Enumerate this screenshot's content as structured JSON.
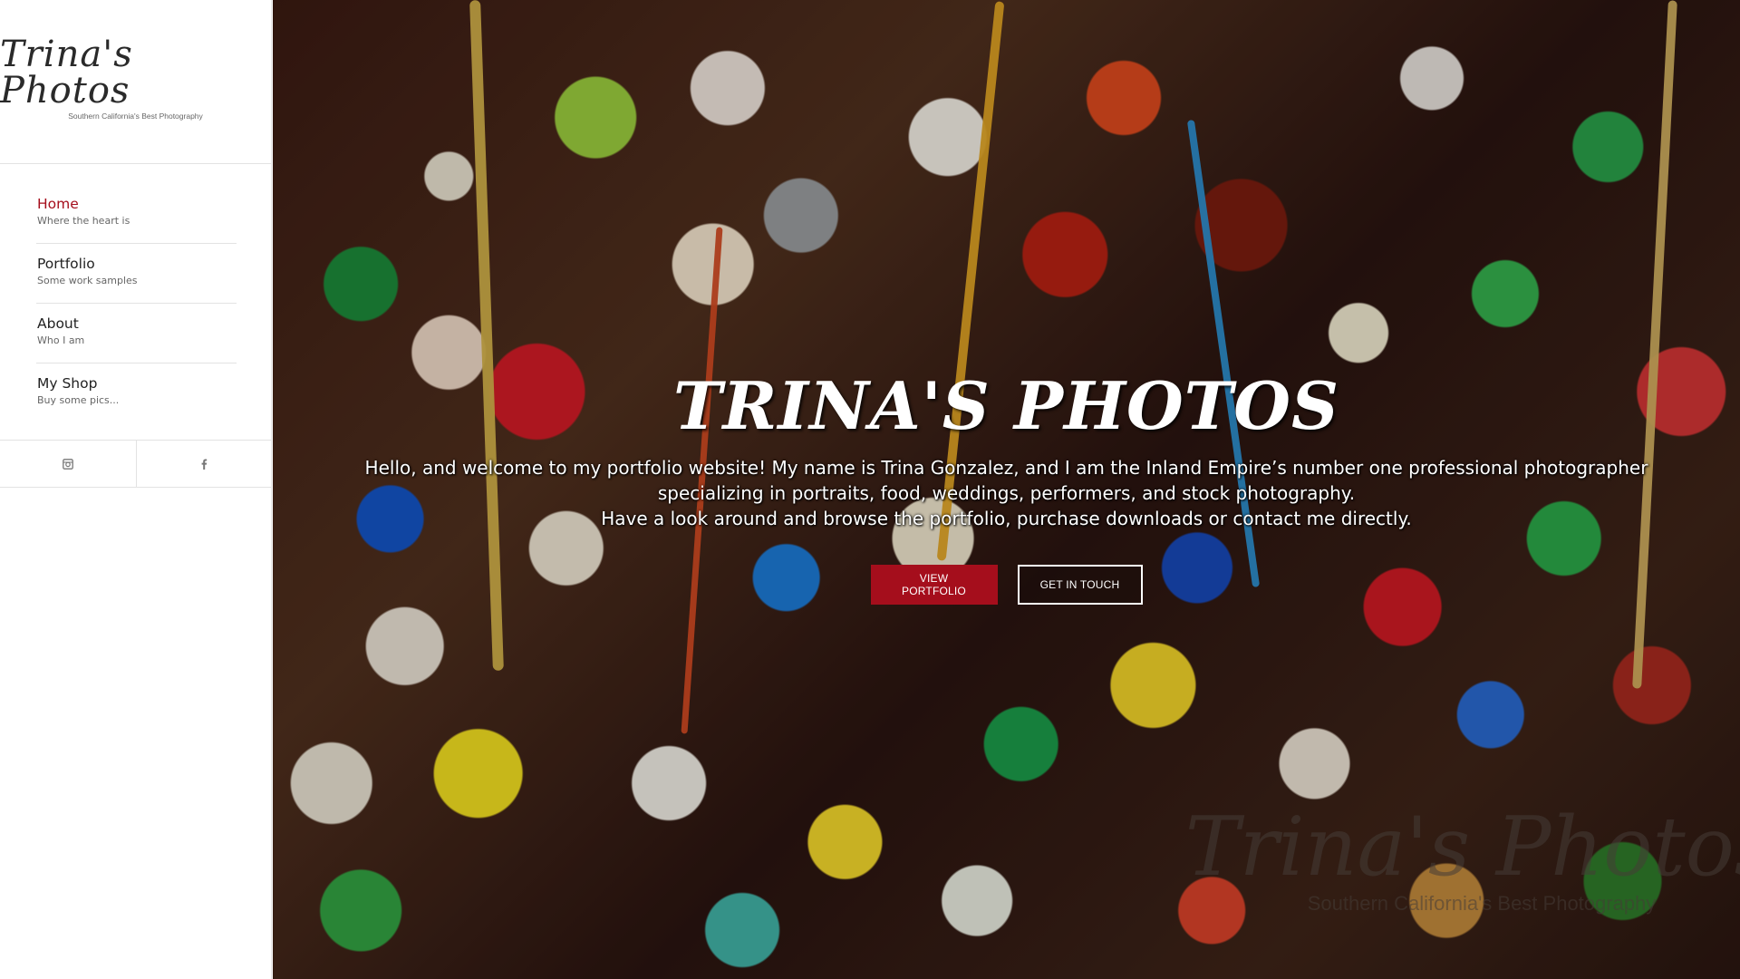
{
  "logo": {
    "title": "Trina's Photos",
    "tagline": "Southern California's Best Photography"
  },
  "nav": {
    "items": [
      {
        "label": "Home",
        "desc": "Where the heart is",
        "active": true
      },
      {
        "label": "Portfolio",
        "desc": "Some work samples"
      },
      {
        "label": "About",
        "desc": "Who I am"
      },
      {
        "label": "My Shop",
        "desc": "Buy some pics..."
      }
    ]
  },
  "social": {
    "icons": [
      "instagram-icon",
      "facebook-icon"
    ]
  },
  "hero": {
    "title": "TRINA'S PHOTOS",
    "text_line1": "Hello, and welcome to my portfolio website! My name is Trina Gonzalez, and I am the Inland Empire’s number one professional photographer",
    "text_line2": "specializing in portraits, food, weddings, performers, and stock photography.",
    "text_line3": "Have a look around and browse the portfolio, purchase downloads or contact me directly.",
    "primary_button": "VIEW PORTFOLIO",
    "secondary_button": "GET IN TOUCH"
  },
  "watermark": {
    "title": "Trina's Photos",
    "subtitle": "Southern California's Best Photography"
  },
  "colors": {
    "accent": "#a50e1c",
    "sidebar_bg": "#ffffff",
    "divider": "#e3e3e3"
  }
}
